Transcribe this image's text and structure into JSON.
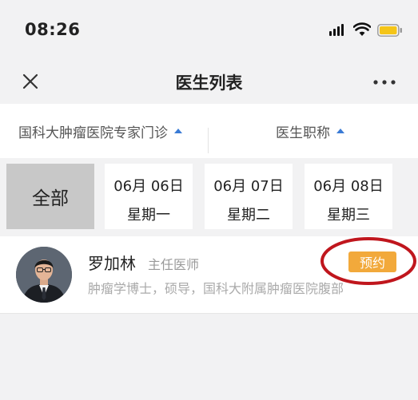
{
  "status_bar": {
    "time": "08:26"
  },
  "nav": {
    "title": "医生列表"
  },
  "filters": {
    "hospital": "国科大肿瘤医院专家门诊",
    "rank": "医生职称"
  },
  "dates": {
    "all_label": "全部",
    "days": [
      {
        "date": "06月 06日",
        "weekday": "星期一"
      },
      {
        "date": "06月 07日",
        "weekday": "星期二"
      },
      {
        "date": "06月 08日",
        "weekday": "星期三"
      }
    ]
  },
  "doctor": {
    "name": "罗加林",
    "title": "主任医师",
    "description": "肿瘤学博士，硕导，国科大附属肿瘤医院腹部",
    "book_label": "预约"
  },
  "colors": {
    "accent": "#3a7bd5",
    "book_button": "#f2a93b",
    "annotation_ring": "#c0161d",
    "battery": "#f5c518"
  }
}
